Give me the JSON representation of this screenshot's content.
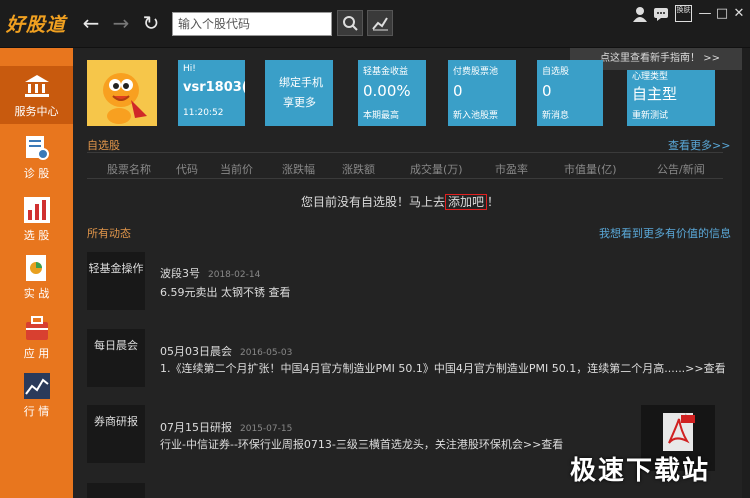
{
  "app": {
    "logo": "好股道"
  },
  "toolbar": {
    "search_placeholder": "输入个股代码",
    "back_icon": "←",
    "forward_icon": "→",
    "refresh_icon": "↻",
    "search_icon": "⌕",
    "trend_icon": "↗",
    "user_icon": "👤",
    "message_icon": "💬",
    "skin_label": "换肤",
    "minimize_icon": "—",
    "maximize_icon": "□",
    "close_icon": "✕",
    "guide_tip": "点这里查看新手指南！ >>"
  },
  "sidebar": {
    "items": [
      {
        "label": "服务中心",
        "icon": "bank-icon"
      },
      {
        "label": "诊 股",
        "icon": "diagnose-icon"
      },
      {
        "label": "选 股",
        "icon": "select-icon"
      },
      {
        "label": "实 战",
        "icon": "practice-icon"
      },
      {
        "label": "应 用",
        "icon": "app-icon"
      },
      {
        "label": "行 情",
        "icon": "market-icon"
      }
    ]
  },
  "user": {
    "greeting": "Hi!",
    "name": "vsr1803(",
    "time": "11:20:52"
  },
  "cards": [
    {
      "title": "",
      "value": "绑定手机",
      "sub": "享更多"
    },
    {
      "title": "轻基金收益",
      "value": "0.00%",
      "sub": "本期最高"
    },
    {
      "title": "付费股票池",
      "value": "0",
      "sub": "新入池股票"
    },
    {
      "title": "自选股",
      "value": "0",
      "sub": "新消息"
    },
    {
      "title": "心理类型",
      "value": "自主型",
      "sub": "重新测试"
    }
  ],
  "watchlist": {
    "title": "自选股",
    "more": "查看更多>>",
    "columns": [
      "股票名称",
      "代码",
      "当前价",
      "涨跌幅",
      "涨跌额",
      "成交量(万)",
      "市盈率",
      "市值量(亿)",
      "公告/新闻"
    ],
    "empty_prefix": "您目前没有自选股！马上去",
    "empty_link": "添加吧",
    "empty_suffix": "！"
  },
  "feed": {
    "title": "所有动态",
    "more": "我想看到更多有价值的信息",
    "items": [
      {
        "tag": "轻基金操作",
        "title": "波段3号",
        "date": "2018-02-14",
        "body": "6.59元卖出 太钢不锈    查看"
      },
      {
        "tag": "每日晨会",
        "title": "05月03日晨会",
        "date": "2016-05-03",
        "body": "1.《连续第二个月扩张！中国4月官方制造业PMI 50.1》中国4月官方制造业PMI 50.1，连续第二个月高......>>查看"
      },
      {
        "tag": "券商研报",
        "title": "07月15日研报",
        "date": "2015-07-15",
        "body": "行业-中信证券--环保行业周报0713-三级三横首选龙头，关注港股环保机会>>查看"
      }
    ]
  },
  "watermark": "极速下载站",
  "colors": {
    "sidebar": "#e8761e",
    "card": "#3a9fc8",
    "section_title": "#e0954a",
    "link": "#5aa8d8"
  }
}
